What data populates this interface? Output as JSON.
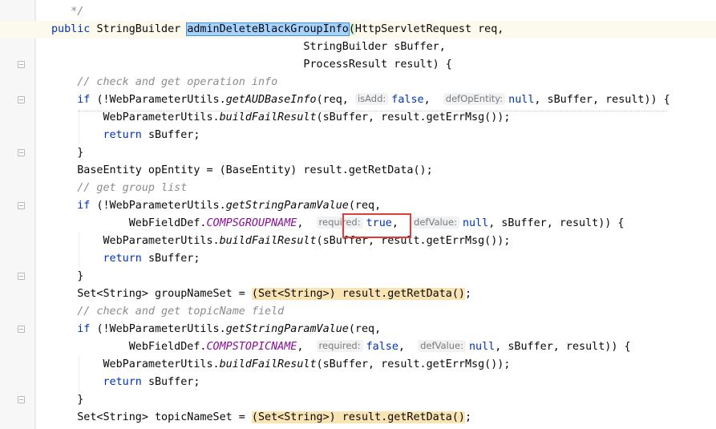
{
  "editor": {
    "lines": [
      [
        {
          "t": "   ",
          "c": ""
        },
        {
          "t": "*/",
          "c": "cm"
        }
      ],
      [
        {
          "t": "public ",
          "c": "kw"
        },
        {
          "t": "StringBuilder ",
          "c": ""
        },
        {
          "t": "adminDeleteBlackGroupInfo",
          "c": "sel"
        },
        {
          "t": "(",
          "c": "brace-hl"
        },
        {
          "t": "HttpServletRequest req,",
          "c": ""
        }
      ],
      [
        {
          "t": "                                       StringBuilder sBuffer,",
          "c": ""
        }
      ],
      [
        {
          "t": "                                       ProcessResult result) {",
          "c": ""
        }
      ],
      [
        {
          "t": "    ",
          "c": ""
        },
        {
          "t": "// check and get operation info",
          "c": "cm"
        }
      ],
      [
        {
          "t": "    ",
          "c": ""
        },
        {
          "t": "if ",
          "c": "kw"
        },
        {
          "t": "(!WebParameterUtils.",
          "c": ""
        },
        {
          "t": "getAUDBaseInfo",
          "c": "it"
        },
        {
          "t": "(req, ",
          "c": ""
        },
        {
          "t": "isAdd:",
          "c": "hint"
        },
        {
          "t": "false",
          "c": "kw"
        },
        {
          "t": ",  ",
          "c": ""
        },
        {
          "t": "defOpEntity:",
          "c": "hint"
        },
        {
          "t": "null",
          "c": "kw"
        },
        {
          "t": ", sBuffer, result)) {",
          "c": ""
        }
      ],
      [
        {
          "t": "        WebParameterUtils.",
          "c": ""
        },
        {
          "t": "buildFailResult",
          "c": "it"
        },
        {
          "t": "(sBuffer, result.getErrMsg());",
          "c": ""
        }
      ],
      [
        {
          "t": "        ",
          "c": ""
        },
        {
          "t": "return ",
          "c": "kw"
        },
        {
          "t": "sBuffer;",
          "c": ""
        }
      ],
      [
        {
          "t": "    }",
          "c": ""
        }
      ],
      [
        {
          "t": "    BaseEntity opEntity = (BaseEntity) result.getRetData();",
          "c": ""
        }
      ],
      [
        {
          "t": "    ",
          "c": ""
        },
        {
          "t": "// get group list",
          "c": "cm"
        }
      ],
      [
        {
          "t": "    ",
          "c": ""
        },
        {
          "t": "if ",
          "c": "kw"
        },
        {
          "t": "(!WebParameterUtils.",
          "c": ""
        },
        {
          "t": "getStringParamValue",
          "c": "it"
        },
        {
          "t": "(req,",
          "c": ""
        }
      ],
      [
        {
          "t": "            WebFieldDef.",
          "c": ""
        },
        {
          "t": "COMPSGROUPNAME",
          "c": "const"
        },
        {
          "t": ",  ",
          "c": ""
        },
        {
          "t": "required:",
          "c": "hint"
        },
        {
          "t": "true",
          "c": "kw"
        },
        {
          "t": ",  ",
          "c": ""
        },
        {
          "t": "defValue:",
          "c": "hint"
        },
        {
          "t": "null",
          "c": "kw"
        },
        {
          "t": ", sBuffer, result)) {",
          "c": ""
        }
      ],
      [
        {
          "t": "        WebParameterUtils.",
          "c": ""
        },
        {
          "t": "buildFailResult",
          "c": "it"
        },
        {
          "t": "(sBuffer, result.getErrMsg());",
          "c": ""
        }
      ],
      [
        {
          "t": "        ",
          "c": ""
        },
        {
          "t": "return ",
          "c": "kw"
        },
        {
          "t": "sBuffer;",
          "c": ""
        }
      ],
      [
        {
          "t": "    }",
          "c": ""
        }
      ],
      [
        {
          "t": "    Set<String> groupNameSet = ",
          "c": ""
        },
        {
          "t": "(Set<String>) result.getRetData()",
          "c": "cast-hl"
        },
        {
          "t": ";",
          "c": ""
        }
      ],
      [
        {
          "t": "    ",
          "c": ""
        },
        {
          "t": "// check and get topicName field",
          "c": "cm"
        }
      ],
      [
        {
          "t": "    ",
          "c": ""
        },
        {
          "t": "if ",
          "c": "kw"
        },
        {
          "t": "(!WebParameterUtils.",
          "c": ""
        },
        {
          "t": "getStringParamValue",
          "c": "it"
        },
        {
          "t": "(req,",
          "c": ""
        }
      ],
      [
        {
          "t": "            WebFieldDef.",
          "c": ""
        },
        {
          "t": "COMPSTOPICNAME",
          "c": "const"
        },
        {
          "t": ",  ",
          "c": ""
        },
        {
          "t": "required:",
          "c": "hint"
        },
        {
          "t": "false",
          "c": "kw"
        },
        {
          "t": ",  ",
          "c": ""
        },
        {
          "t": "defValue:",
          "c": "hint"
        },
        {
          "t": "null",
          "c": "kw"
        },
        {
          "t": ", sBuffer, result)) {",
          "c": ""
        }
      ],
      [
        {
          "t": "        WebParameterUtils.",
          "c": ""
        },
        {
          "t": "buildFailResult",
          "c": "it"
        },
        {
          "t": "(sBuffer, result.getErrMsg());",
          "c": ""
        }
      ],
      [
        {
          "t": "        ",
          "c": ""
        },
        {
          "t": "return ",
          "c": "kw"
        },
        {
          "t": "sBuffer;",
          "c": ""
        }
      ],
      [
        {
          "t": "    }",
          "c": ""
        }
      ],
      [
        {
          "t": "    Set<String> topicNameSet = ",
          "c": ""
        },
        {
          "t": "(Set<String>) result.getRetData()",
          "c": "cast-hl"
        },
        {
          "t": ";",
          "c": ""
        }
      ]
    ],
    "highlighted_line_index": 1,
    "colors": {
      "keyword": "#0033b3",
      "comment": "#8c8c8c",
      "constant": "#871094",
      "selection": "#a6d2ff",
      "annotation_box": "#e23b3b"
    },
    "fold_markers": [
      1,
      3,
      5,
      8,
      11,
      15,
      18,
      22
    ],
    "annotation": "red-box-around-required-true"
  }
}
